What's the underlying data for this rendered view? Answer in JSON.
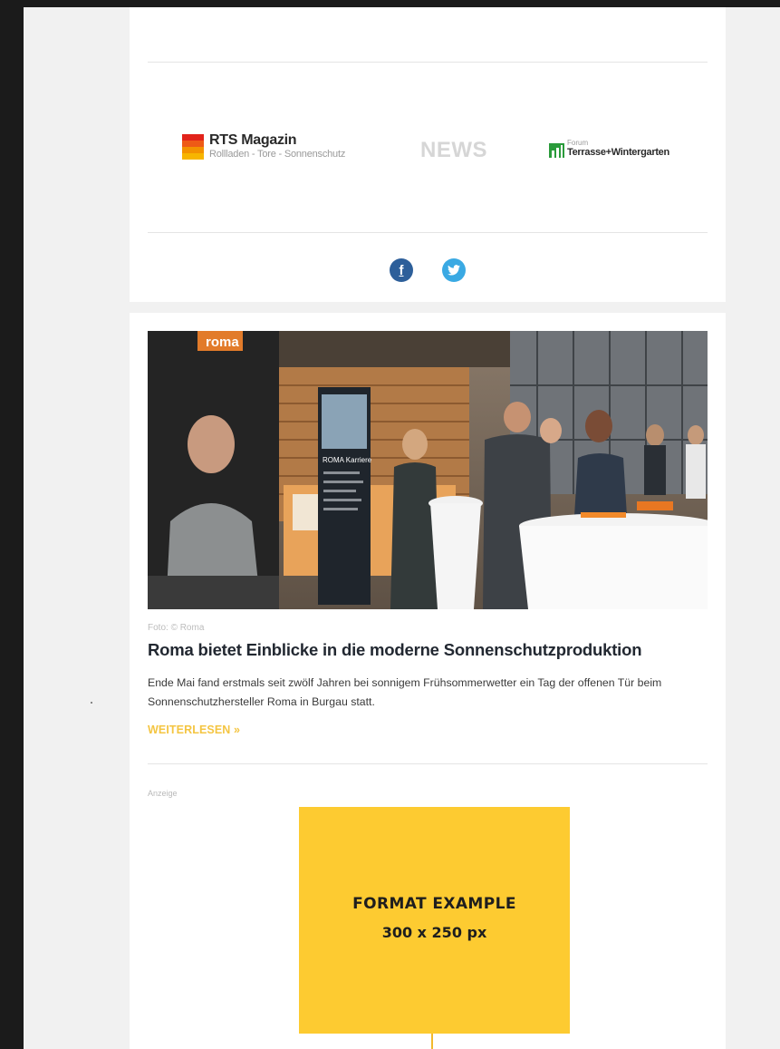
{
  "header": {
    "brands": {
      "rts": {
        "title": "RTS Magazin",
        "subtitle": "Rollladen - Tore - Sonnenschutz"
      },
      "news": {
        "label": "NEWS"
      },
      "forum": {
        "small": "Forum",
        "big": "Terrasse+Wintergarten"
      }
    },
    "social": {
      "facebook": {
        "icon": "facebook-icon",
        "glyph": "f"
      },
      "twitter": {
        "icon": "twitter-icon"
      }
    }
  },
  "article": {
    "image_sign": "roma",
    "image_banner": "ROMA Karriere",
    "credit": "Foto: © Roma",
    "headline": "Roma bietet Einblicke in die moderne Sonnenschutzproduktion",
    "teaser": "Ende Mai fand erstmals seit zwölf Jahren bei sonnigem Frühsommerwetter ein Tag der offenen Tür beim Sonnenschutzhersteller Roma in Burgau statt.",
    "read_more": "WEITERLESEN",
    "read_more_glyph": "»"
  },
  "ad": {
    "label": "Anzeige",
    "line1": "FORMAT EXAMPLE",
    "line2": "300 x 250 px"
  },
  "colors": {
    "accent_yellow": "#fdcb31",
    "link_yellow": "#f4c542",
    "rts_orange": "#f39200",
    "rts_red": "#e2231a",
    "forum_green": "#2a9b3b",
    "facebook_blue": "#2d5f9a",
    "twitter_blue": "#3aa9e3"
  }
}
